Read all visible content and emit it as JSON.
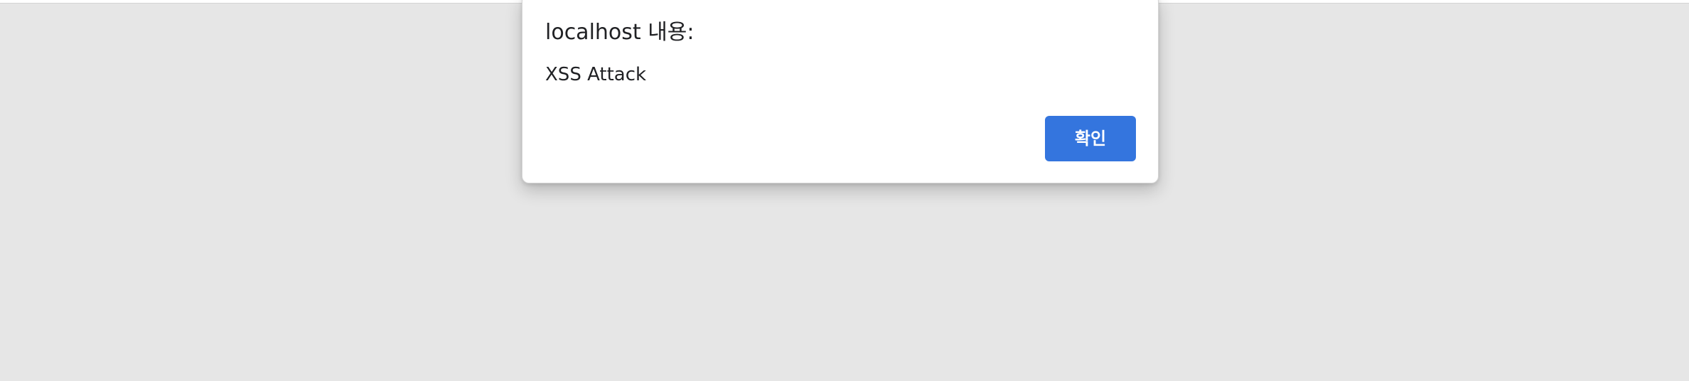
{
  "dialog": {
    "title": "localhost 내용:",
    "message": "XSS Attack",
    "ok_label": "확인"
  },
  "colors": {
    "background": "#e6e6e6",
    "dialog": "#ffffff",
    "button": "#3475de",
    "text": "#202124"
  }
}
